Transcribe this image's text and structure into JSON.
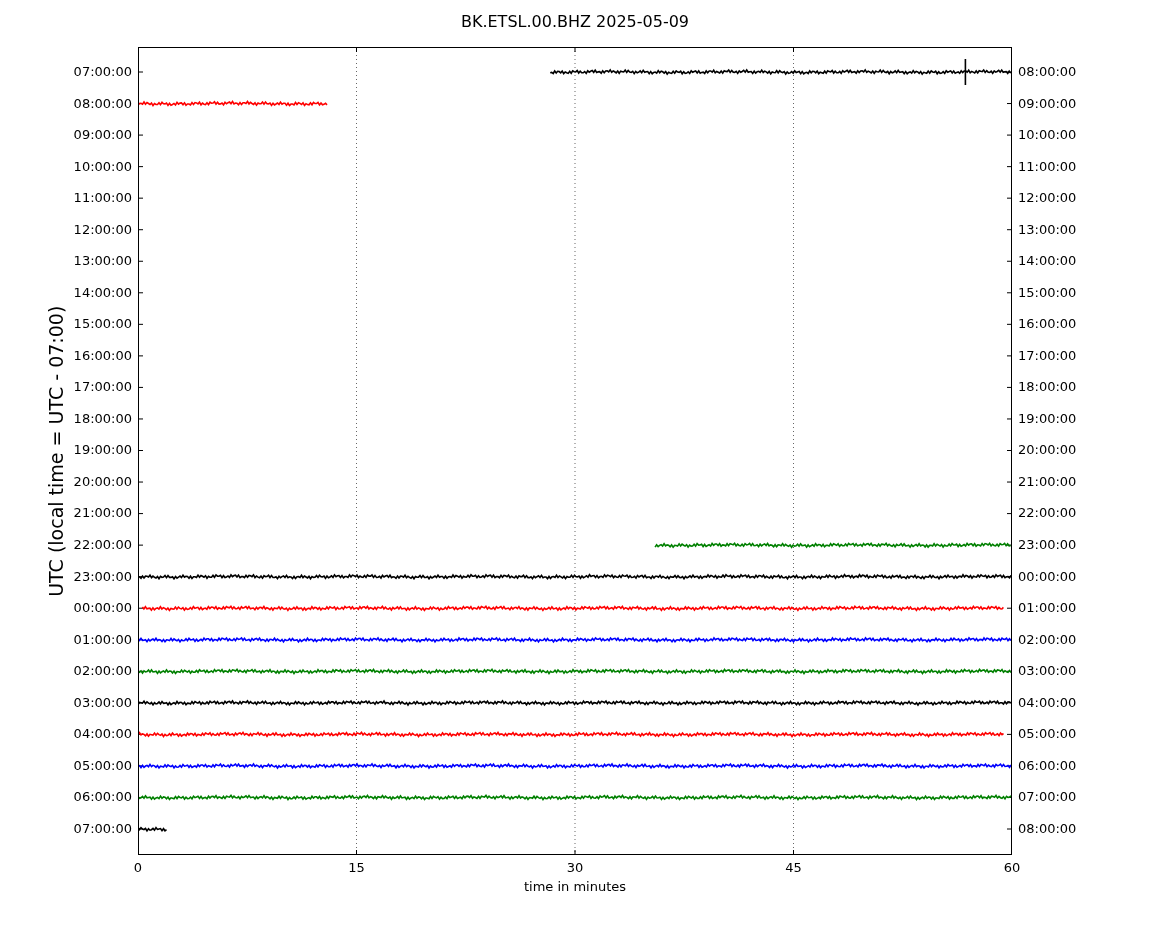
{
  "title": "BK.ETSL.00.BHZ 2025-05-09",
  "ylabel": "UTC (local time = UTC - 07:00)",
  "xlabel": "time in minutes",
  "xticks": [
    "0",
    "15",
    "30",
    "45",
    "60"
  ],
  "rows": [
    {
      "left": "07:00:00",
      "right": "08:00:00",
      "color": "#000000"
    },
    {
      "left": "08:00:00",
      "right": "09:00:00",
      "color": "#ff0000"
    },
    {
      "left": "09:00:00",
      "right": "10:00:00"
    },
    {
      "left": "10:00:00",
      "right": "11:00:00"
    },
    {
      "left": "11:00:00",
      "right": "12:00:00"
    },
    {
      "left": "12:00:00",
      "right": "13:00:00"
    },
    {
      "left": "13:00:00",
      "right": "14:00:00"
    },
    {
      "left": "14:00:00",
      "right": "15:00:00"
    },
    {
      "left": "15:00:00",
      "right": "16:00:00"
    },
    {
      "left": "16:00:00",
      "right": "17:00:00"
    },
    {
      "left": "17:00:00",
      "right": "18:00:00"
    },
    {
      "left": "18:00:00",
      "right": "19:00:00"
    },
    {
      "left": "19:00:00",
      "right": "20:00:00"
    },
    {
      "left": "20:00:00",
      "right": "21:00:00"
    },
    {
      "left": "21:00:00",
      "right": "22:00:00"
    },
    {
      "left": "22:00:00",
      "right": "23:00:00",
      "color": "#008000"
    },
    {
      "left": "23:00:00",
      "right": "00:00:00",
      "color": "#000000"
    },
    {
      "left": "00:00:00",
      "right": "01:00:00",
      "color": "#ff0000"
    },
    {
      "left": "01:00:00",
      "right": "02:00:00",
      "color": "#0000ff"
    },
    {
      "left": "02:00:00",
      "right": "03:00:00",
      "color": "#008000"
    },
    {
      "left": "03:00:00",
      "right": "04:00:00",
      "color": "#000000"
    },
    {
      "left": "04:00:00",
      "right": "05:00:00",
      "color": "#ff0000"
    },
    {
      "left": "05:00:00",
      "right": "06:00:00",
      "color": "#0000ff"
    },
    {
      "left": "06:00:00",
      "right": "07:00:00",
      "color": "#008000"
    },
    {
      "left": "07:00:00",
      "right": "08:00:00",
      "color": "#000000"
    }
  ]
}
